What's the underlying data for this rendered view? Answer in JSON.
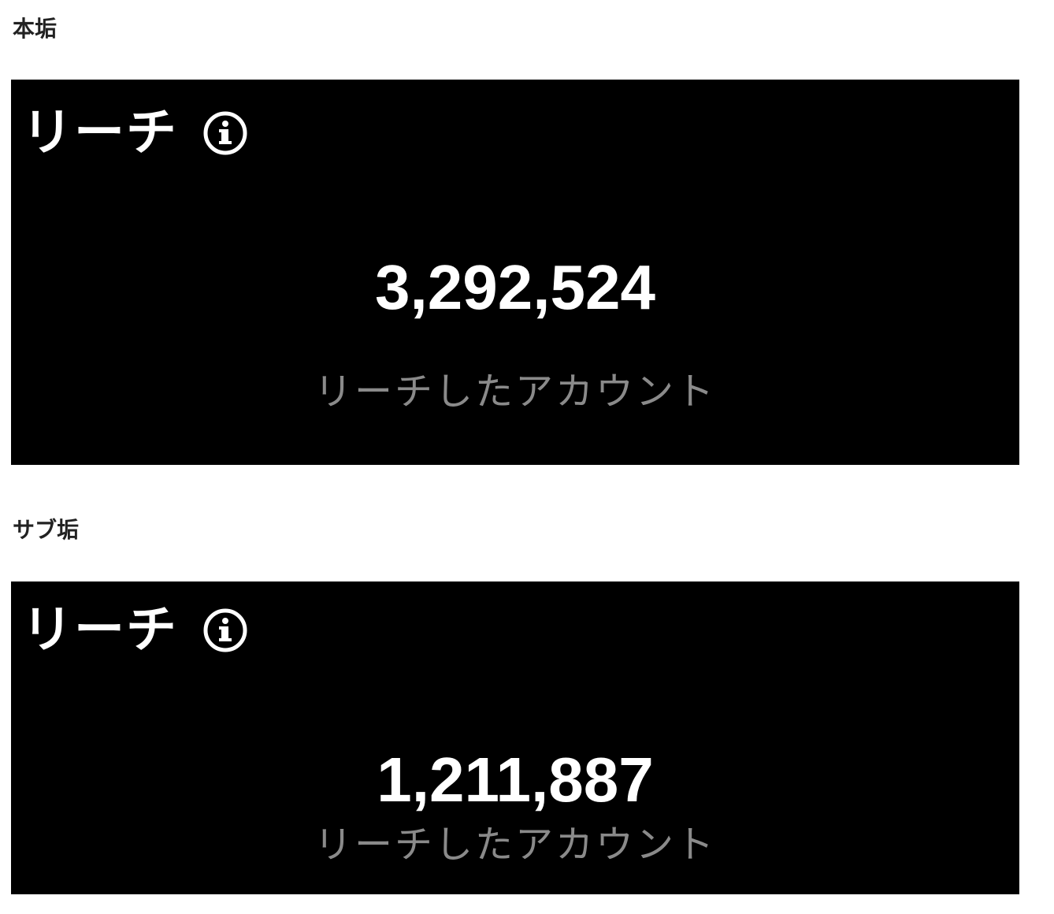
{
  "sections": [
    {
      "label": "本垢",
      "title": "リーチ",
      "icon": "info-icon",
      "value": "3,292,524",
      "caption": "リーチしたアカウント"
    },
    {
      "label": "サブ垢",
      "title": "リーチ",
      "icon": "info-icon",
      "value": "1,211,887",
      "caption": "リーチしたアカウント"
    }
  ],
  "colors": {
    "panel_background": "#000000",
    "value_text": "#ffffff",
    "caption_text": "#8a8a8a",
    "label_text": "#222222"
  }
}
